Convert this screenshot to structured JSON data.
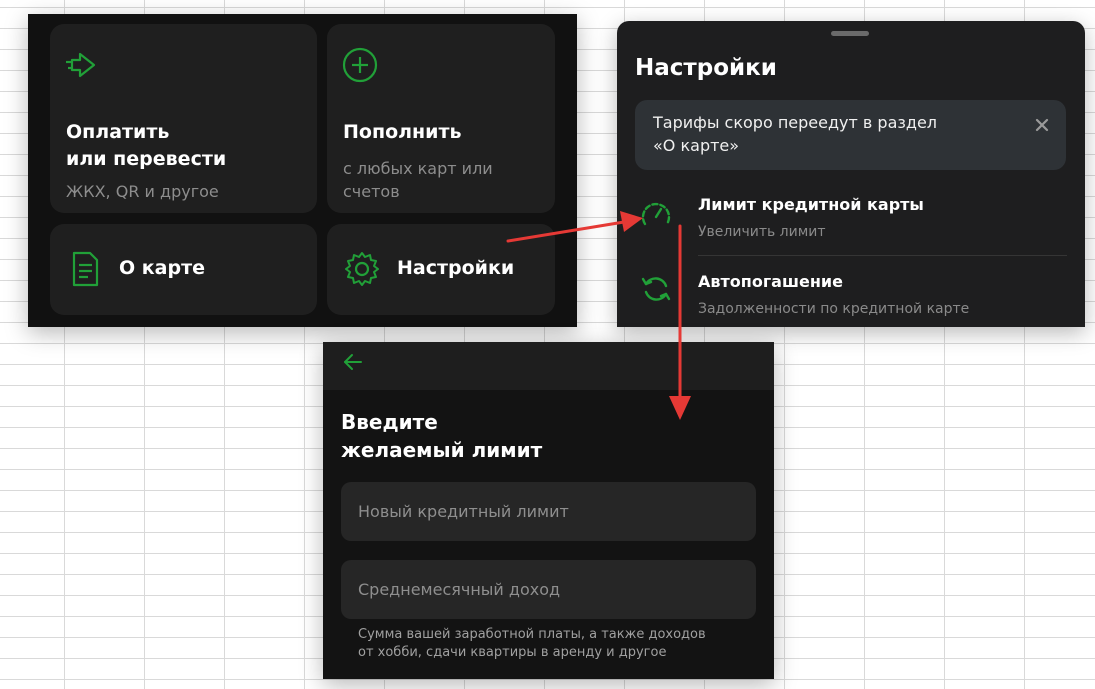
{
  "menu": {
    "tiles": [
      {
        "title_line1": "Оплатить",
        "title_line2": "или перевести",
        "subtitle": "ЖКХ, QR и другое",
        "icon": "transfer-arrow-icon"
      },
      {
        "title": "Пополнить",
        "subtitle_line1": "с любых карт или",
        "subtitle_line2": "счетов",
        "icon": "plus-circle-icon"
      },
      {
        "title": "О карте",
        "icon": "document-icon"
      },
      {
        "title": "Настройки",
        "icon": "gear-icon"
      }
    ]
  },
  "settings": {
    "title": "Настройки",
    "notice": {
      "text_line1": "Тарифы скоро переедут в раздел",
      "text_line2": "«О карте»"
    },
    "items": [
      {
        "title": "Лимит кредитной карты",
        "subtitle": "Увеличить лимит",
        "icon": "speedometer-icon"
      },
      {
        "title": "Автопогашение",
        "subtitle": "Задолженности по кредитной карте",
        "icon": "refresh-icon"
      }
    ]
  },
  "limit_screen": {
    "title_line1": "Введите",
    "title_line2": "желаемый лимит",
    "new_limit_placeholder": "Новый кредитный лимит",
    "income_placeholder": "Среднемесячный доход",
    "hint_line1": "Сумма вашей заработной платы, а также доходов",
    "hint_line2": "от хобби, сдачи квартиры в аренду и другое"
  },
  "colors": {
    "accent": "#21a038",
    "annotation_arrow": "#e53935"
  }
}
